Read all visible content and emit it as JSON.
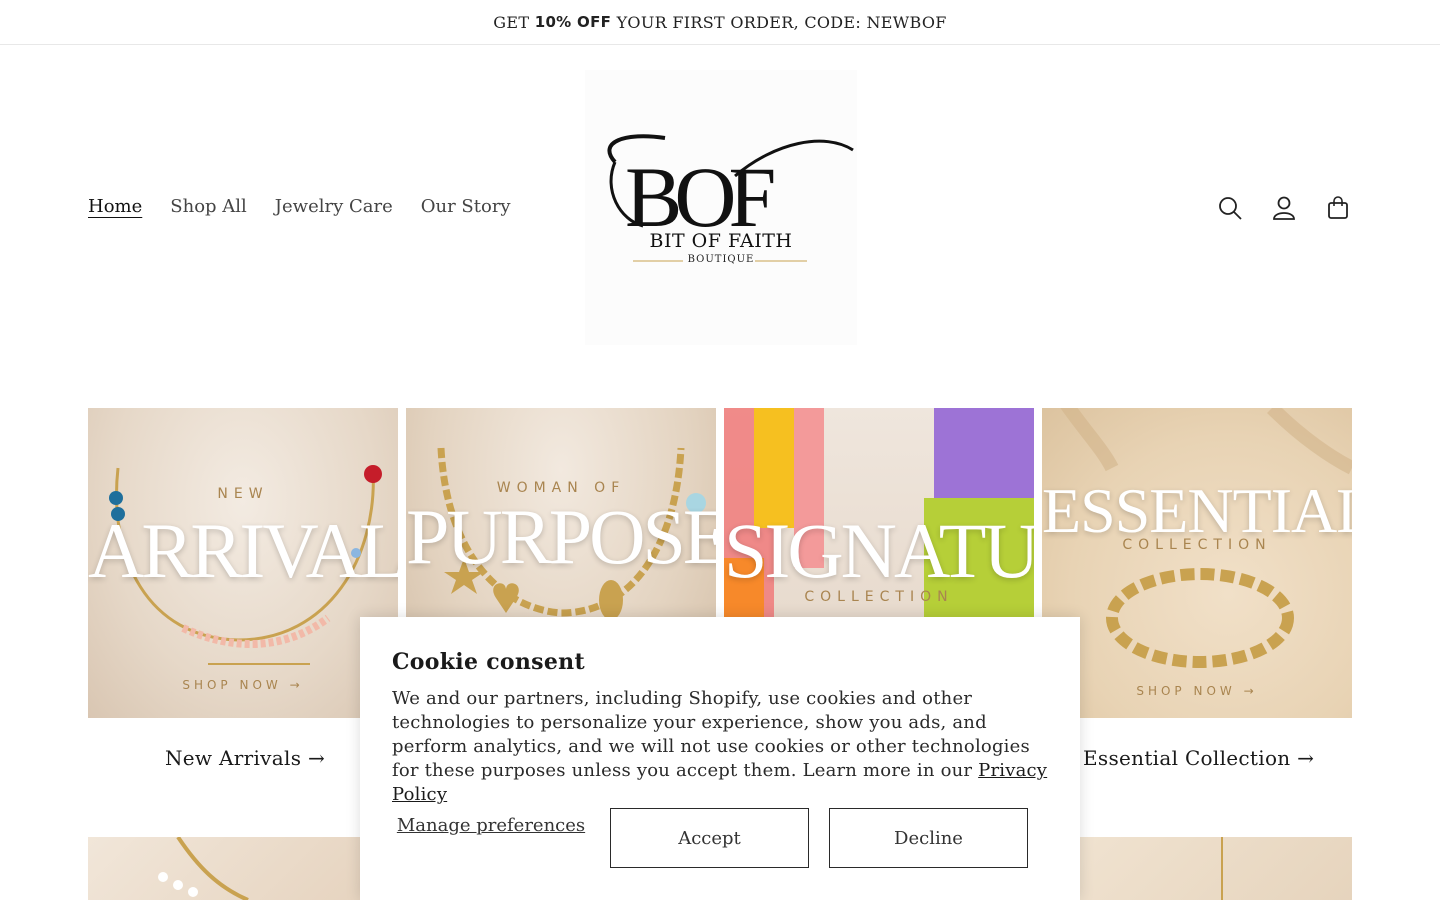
{
  "announcement": {
    "prefix": "GET ",
    "bold": "10% OFF",
    "suffix": " YOUR FIRST ORDER, CODE: NEWBOF"
  },
  "nav": [
    {
      "label": "Home",
      "active": true
    },
    {
      "label": "Shop All"
    },
    {
      "label": "Jewelry Care"
    },
    {
      "label": "Our Story"
    }
  ],
  "logo": {
    "monogram": "BOF",
    "name": "BIT OF FAITH",
    "sub": "BOUTIQUE"
  },
  "header_icons": [
    "search-icon",
    "account-icon",
    "cart-icon"
  ],
  "collections": [
    {
      "overline": "NEW",
      "title": "ARRIVALS",
      "shop": "SHOP NOW",
      "caption": "New Arrivals"
    },
    {
      "overline": "WOMAN OF",
      "title": "PURPOSE",
      "caption": ""
    },
    {
      "title": "SIGNATURE",
      "underline": "COLLECTION",
      "caption": ""
    },
    {
      "title": "ESSENTIAL",
      "underline": "COLLECTION",
      "shop": "SHOP NOW",
      "caption": "Essential Collection"
    }
  ],
  "cookie": {
    "title": "Cookie consent",
    "body": "We and our partners, including Shopify, use cookies and other technologies to personalize your experience, show you ads, and perform analytics, and we will not use cookies or other technologies for these purposes unless you accept them. Learn more in our ",
    "link": "Privacy Policy",
    "manage": "Manage preferences",
    "accept": "Accept",
    "decline": "Decline"
  },
  "colors": {
    "accent": "#1a1a1a",
    "gold": "#c9a250"
  }
}
